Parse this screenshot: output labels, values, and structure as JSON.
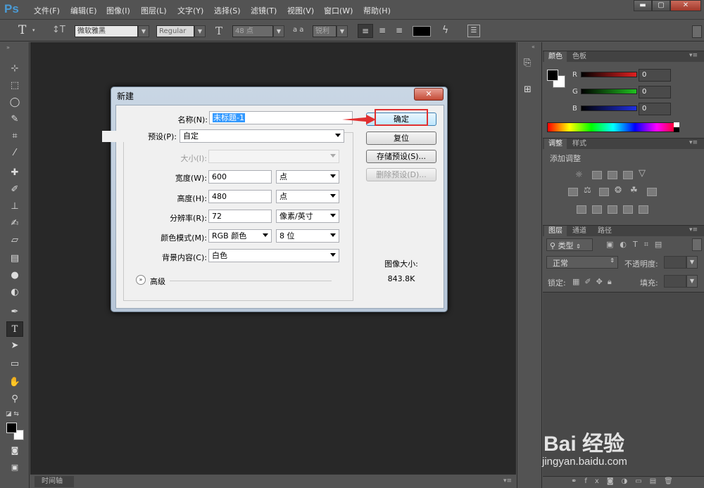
{
  "app": {
    "logo": "Ps"
  },
  "menu": [
    "文件(F)",
    "编辑(E)",
    "图像(I)",
    "图层(L)",
    "文字(Y)",
    "选择(S)",
    "滤镜(T)",
    "视图(V)",
    "窗口(W)",
    "帮助(H)"
  ],
  "window_buttons": [
    "▬",
    "▢",
    "✕"
  ],
  "options": {
    "tool_glyph": "T",
    "font_family": "微软雅黑",
    "font_style": "Regular",
    "font_size": "48 点",
    "aa_label": "a a",
    "aa_mode": "锐利"
  },
  "panels": {
    "color": {
      "tabs": [
        "颜色",
        "色板"
      ],
      "channels": [
        {
          "name": "R",
          "value": "0",
          "color": "#e02020"
        },
        {
          "name": "G",
          "value": "0",
          "color": "#20c020"
        },
        {
          "name": "B",
          "value": "0",
          "color": "#2030e0"
        }
      ]
    },
    "adjust": {
      "tabs": [
        "调整",
        "样式"
      ],
      "title": "添加调整"
    },
    "layers": {
      "tabs": [
        "图层",
        "通道",
        "路径"
      ],
      "filter": "类型",
      "blend": "正常",
      "opacity_label": "不透明度:",
      "lock_label": "锁定:",
      "fill_label": "填充:"
    }
  },
  "timeline": {
    "label": "时间轴"
  },
  "dialog": {
    "title": "新建",
    "close": "✕",
    "name_label": "名称(N):",
    "name_value": "未标题-1",
    "preset_label": "预设(P):",
    "preset_value": "自定",
    "size_label": "大小(I):",
    "size_value": "",
    "width_label": "宽度(W):",
    "width_value": "600",
    "width_unit": "点",
    "height_label": "高度(H):",
    "height_value": "480",
    "height_unit": "点",
    "res_label": "分辨率(R):",
    "res_value": "72",
    "res_unit": "像素/英寸",
    "mode_label": "颜色模式(M):",
    "mode_value": "RGB 颜色",
    "mode_depth": "8 位",
    "bg_label": "背景内容(C):",
    "bg_value": "白色",
    "advanced_label": "高级",
    "ok": "确定",
    "reset": "复位",
    "save_preset": "存储预设(S)...",
    "delete_preset": "删除预设(D)...",
    "image_size_label": "图像大小:",
    "image_size_value": "843.8K"
  },
  "watermark": {
    "brand": "Bai 经验",
    "url": "jingyan.baidu.com"
  }
}
